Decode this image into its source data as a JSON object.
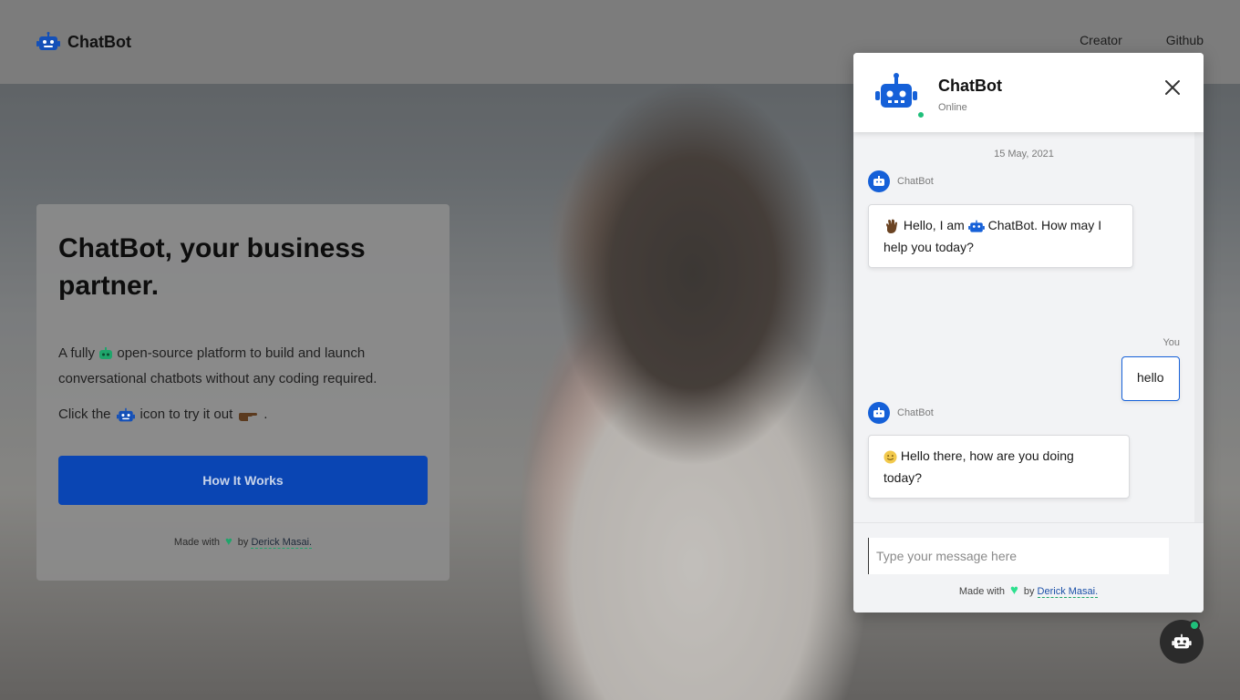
{
  "nav": {
    "brand": "ChatBot",
    "links": [
      "Creator",
      "Github"
    ]
  },
  "hero": {
    "title": "ChatBot, your business partner.",
    "desc_part1": "A fully",
    "desc_part2": "open-source platform to build and launch conversational chatbots without any coding required.",
    "cta_part1": "Click the",
    "cta_part2": "icon to try it out",
    "cta_part3": ".",
    "button": "How It Works",
    "footer_prefix": "Made with",
    "footer_by": "by",
    "footer_author": "Derick Masai."
  },
  "chat": {
    "title": "ChatBot",
    "status": "Online",
    "date": "15 May, 2021",
    "messages": [
      {
        "sender": "ChatBot",
        "text_part1": "Hello, I am",
        "text_part2": "ChatBot. How may I help you today?"
      },
      {
        "sender": "You",
        "text": "hello"
      },
      {
        "sender": "ChatBot",
        "text": "Hello there, how are you doing today?"
      }
    ],
    "input_placeholder": "Type your message here",
    "footer_prefix": "Made with",
    "footer_by": "by",
    "footer_author": "Derick Masai."
  },
  "colors": {
    "primary": "#1560d8",
    "button": "#0a45b3",
    "online": "#1fbf7a"
  },
  "icons": {
    "brand": "robot-icon",
    "close": "close-icon",
    "launcher": "robot-icon",
    "wave": "waving-hand-icon",
    "smile": "smile-icon",
    "point": "pointing-hand-icon",
    "heart": "heart-icon"
  }
}
